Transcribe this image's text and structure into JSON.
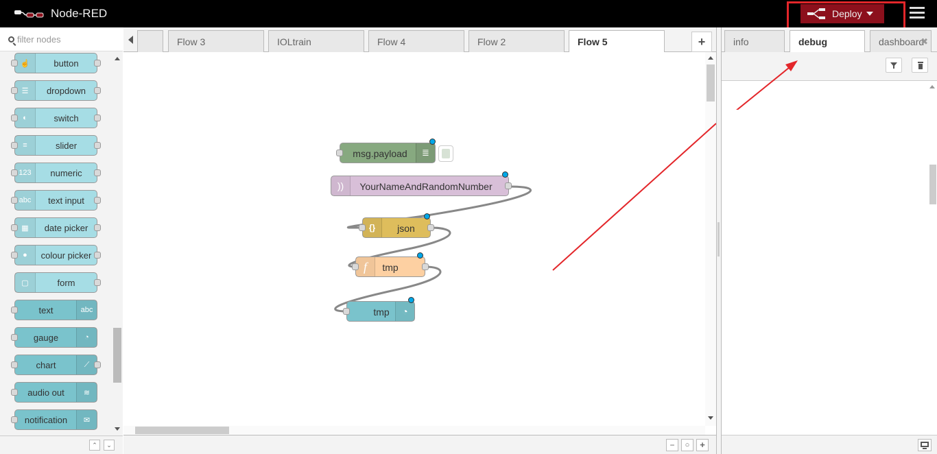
{
  "header": {
    "title": "Node-RED",
    "deploy_label": "Deploy",
    "accent": "#8c101c",
    "highlight_color": "#e3262a"
  },
  "palette": {
    "search_placeholder": "filter nodes",
    "nodes": [
      {
        "label": "button",
        "icon": "hand-pointer-icon"
      },
      {
        "label": "dropdown",
        "icon": "list-icon"
      },
      {
        "label": "switch",
        "icon": "toggle-icon"
      },
      {
        "label": "slider",
        "icon": "sliders-icon"
      },
      {
        "label": "numeric",
        "icon": "numeric-123-icon",
        "icon_text": "123"
      },
      {
        "label": "text input",
        "icon": "text-input-abc-icon",
        "icon_text": "abc"
      },
      {
        "label": "date picker",
        "icon": "calendar-icon"
      },
      {
        "label": "colour picker",
        "icon": "palette-icon"
      },
      {
        "label": "form",
        "icon": "form-icon"
      },
      {
        "label": "text",
        "icon": "text-abc-icon",
        "icon_text": "abc"
      },
      {
        "label": "gauge",
        "icon": "gauge-icon"
      },
      {
        "label": "chart",
        "icon": "chart-line-icon"
      },
      {
        "label": "audio out",
        "icon": "audio-icon"
      },
      {
        "label": "notification",
        "icon": "envelope-icon"
      }
    ]
  },
  "workspace": {
    "tabs": [
      "Flow 3",
      "IOLtrain",
      "Flow 4",
      "Flow 2",
      "Flow 5"
    ],
    "active_tab": "Flow 5",
    "flow_nodes": [
      {
        "label": "msg.payload",
        "type": "debug",
        "color": "#87a980"
      },
      {
        "label": "YourNameAndRandomNumber",
        "type": "mqtt in",
        "color": "#d8bfd8"
      },
      {
        "label": "json",
        "type": "json",
        "color": "#debd5c"
      },
      {
        "label": "tmp",
        "type": "function",
        "color": "#fdd0a2"
      },
      {
        "label": "tmp",
        "type": "gauge",
        "color": "#7ac3cc"
      }
    ]
  },
  "sidebar": {
    "tabs": [
      "info",
      "debug",
      "dashboard"
    ],
    "active_tab": "debug"
  }
}
